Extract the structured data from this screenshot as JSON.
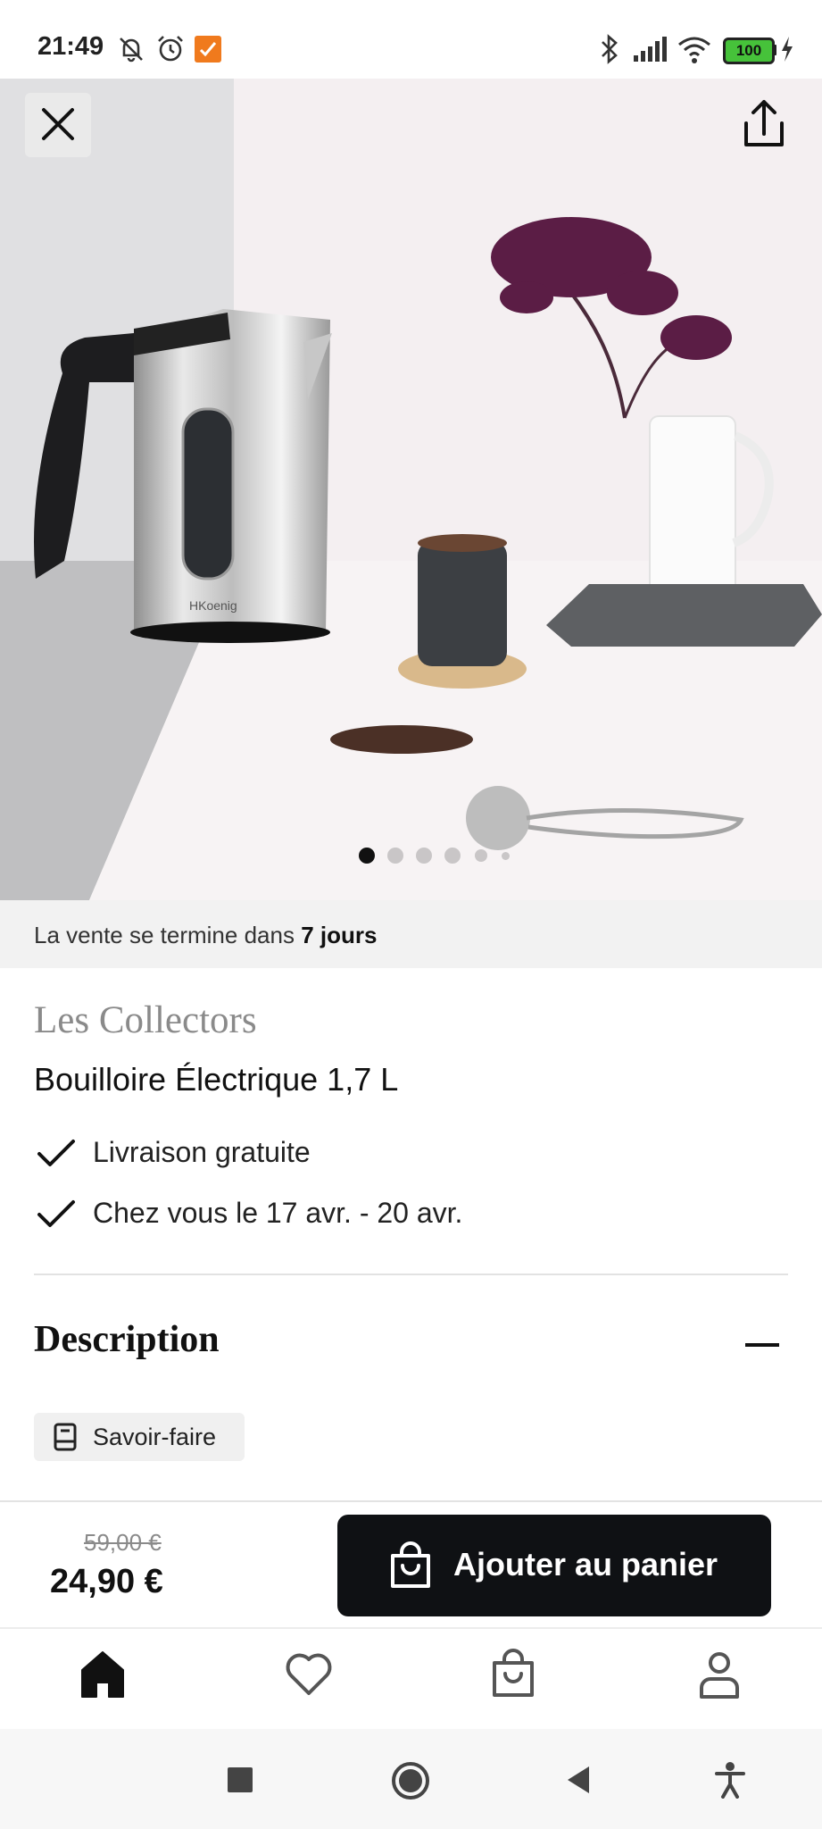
{
  "status_bar": {
    "time": "21:49",
    "icons": [
      "muted-bell-icon",
      "alarm-icon",
      "app-notification-icon",
      "bluetooth-icon",
      "signal-icon",
      "wifi-icon",
      "battery-icon",
      "charging-icon"
    ],
    "battery_level": "100"
  },
  "hero": {
    "brand_mark": "HKoenig",
    "carousel": {
      "total": 6,
      "active_index": 0
    }
  },
  "sale": {
    "prefix": "La vente se termine dans",
    "duration": "7 jours"
  },
  "product": {
    "brand": "Les Collectors",
    "title": "Bouilloire Électrique 1,7 L",
    "features": [
      {
        "label": "Livraison gratuite"
      },
      {
        "label": "Chez vous le 17 avr. - 20 avr."
      }
    ]
  },
  "description": {
    "title": "Description",
    "chip_label": "Savoir-faire"
  },
  "pricing": {
    "old_price": "59,00 €",
    "price": "24,90 €",
    "add_to_cart_label": "Ajouter au panier"
  },
  "tab_bar": {
    "items": [
      "home-icon",
      "favorites-icon",
      "cart-icon",
      "account-icon"
    ],
    "active": "home"
  },
  "system_nav": [
    "recent-apps-button",
    "home-button",
    "back-button",
    "accessibility-button"
  ],
  "colors": {
    "accent": "#0f1114",
    "battery": "#46c23a",
    "banner_bg": "#f2f2f2"
  }
}
